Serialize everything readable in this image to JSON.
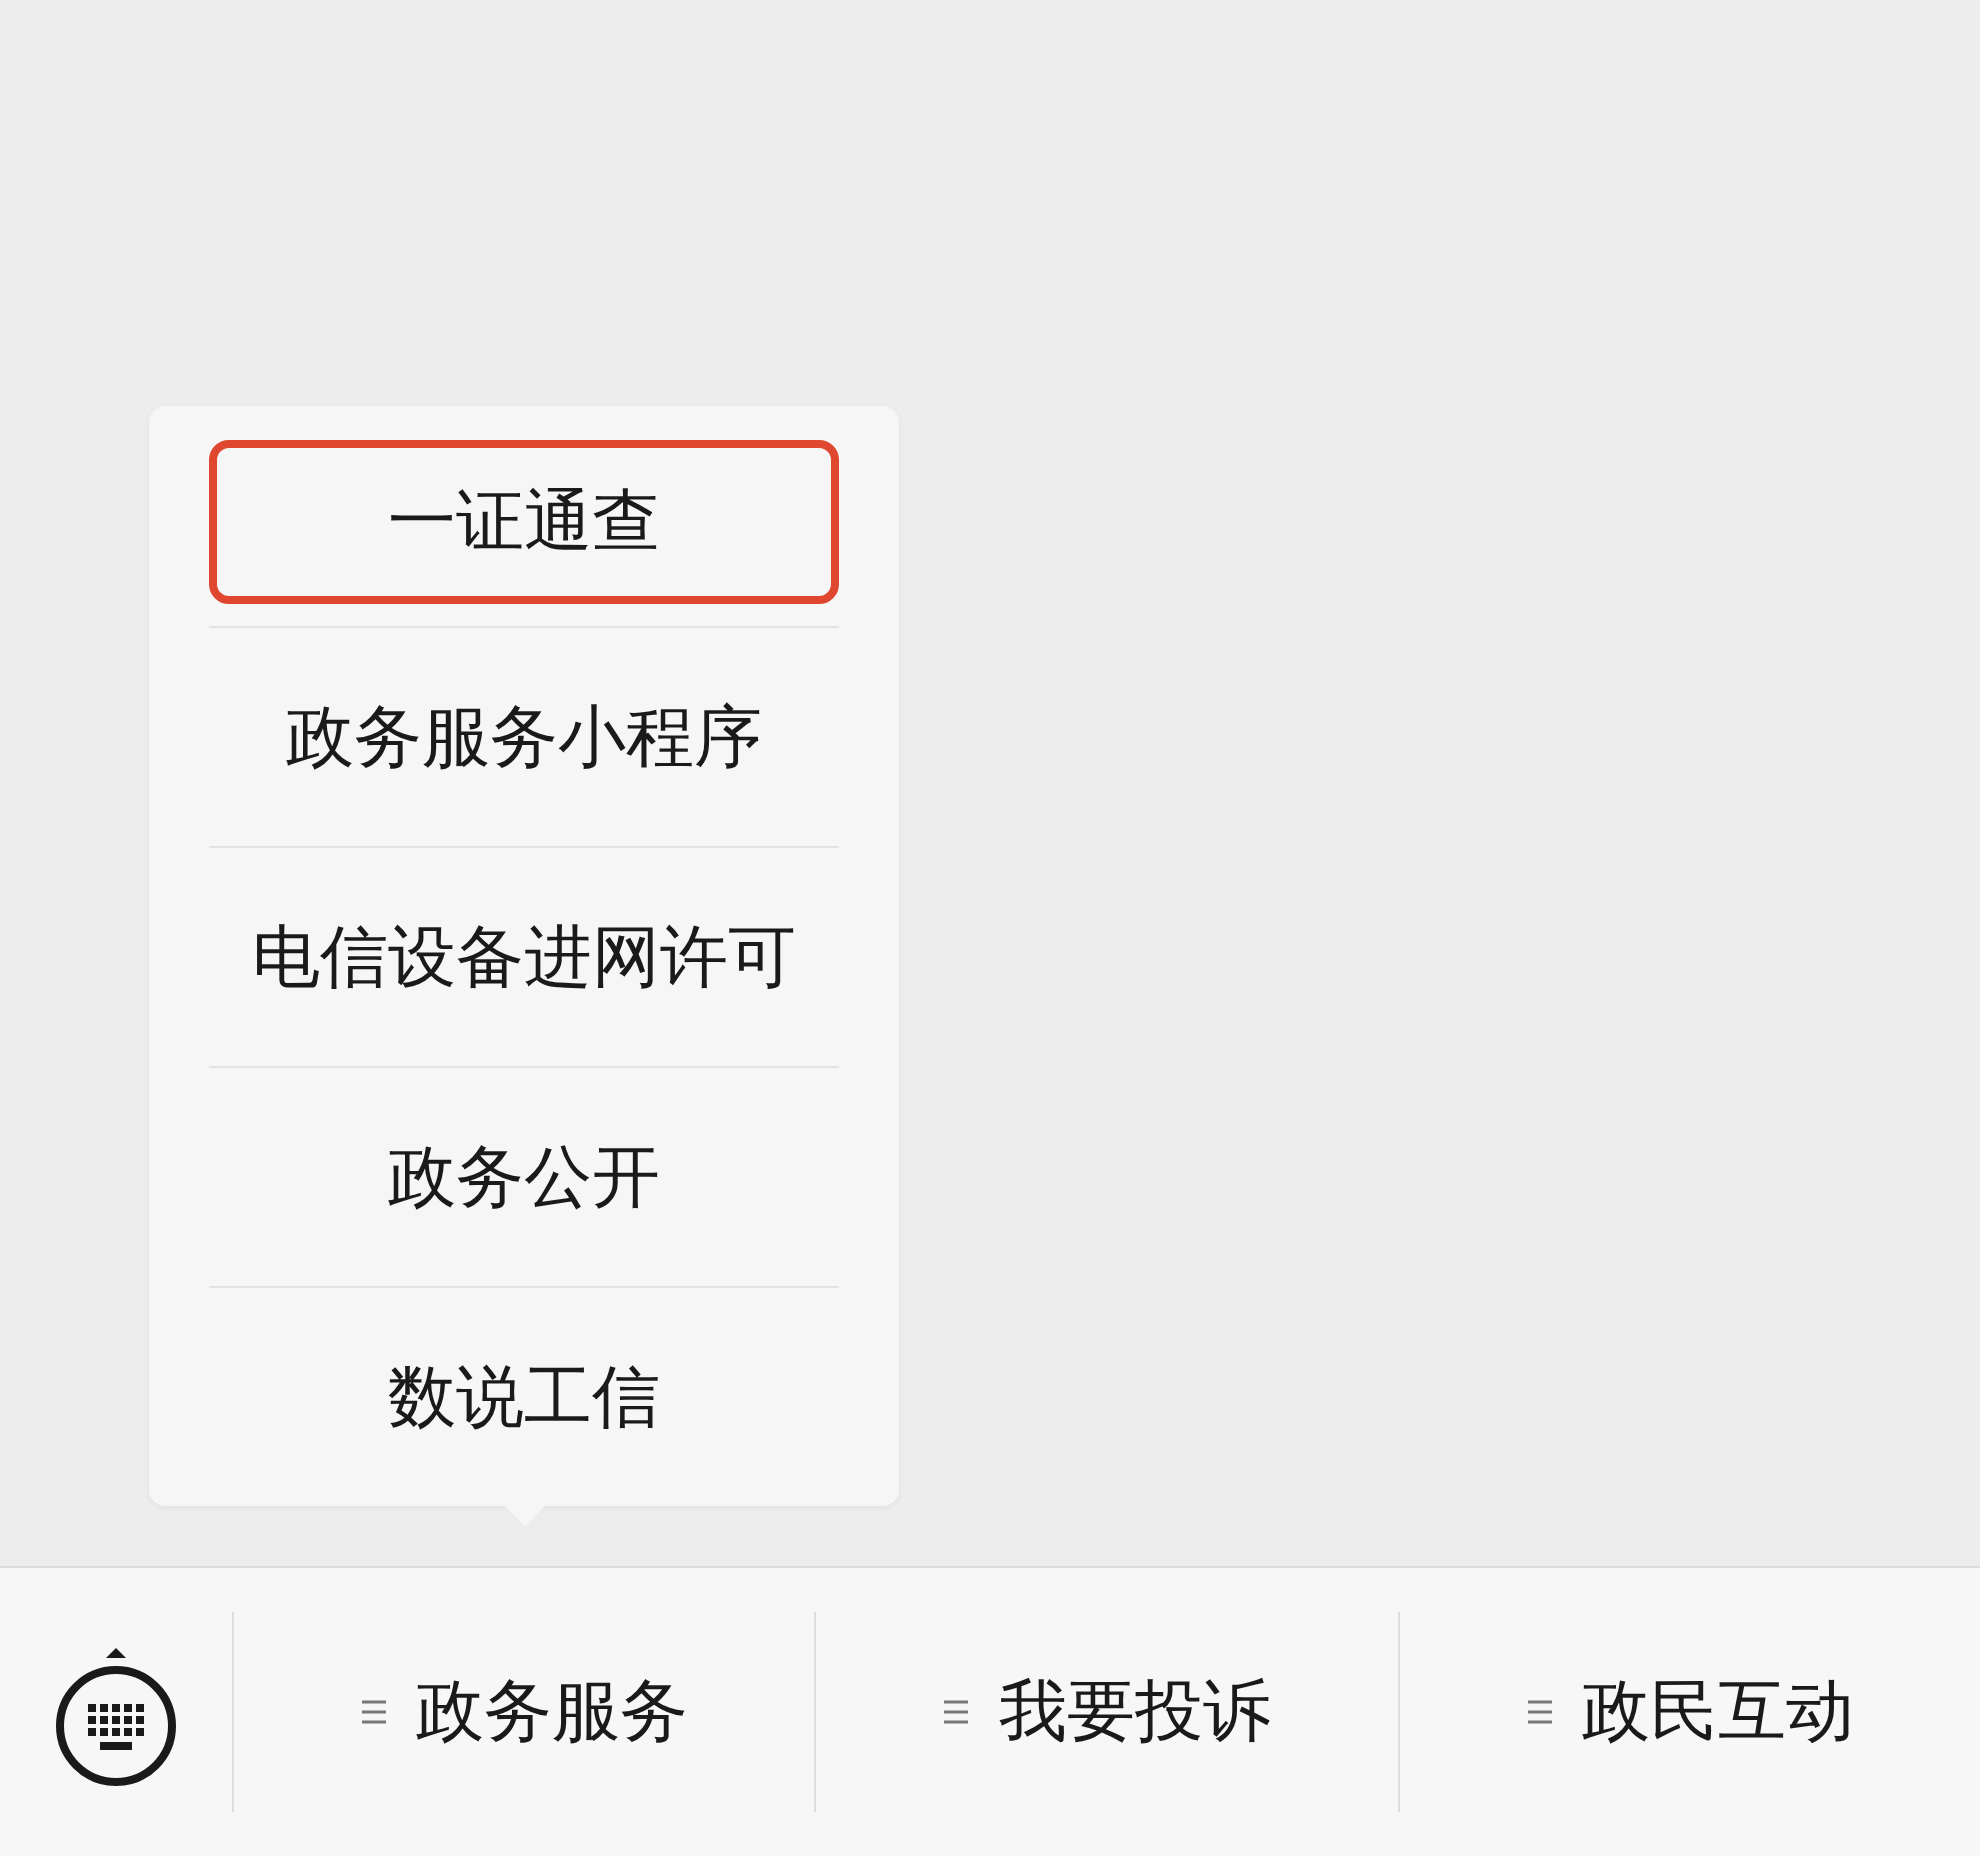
{
  "tabs": [
    {
      "label": "政务服务",
      "submenu": [
        {
          "label": "一证通查",
          "selected": true
        },
        {
          "label": "政务服务小程序",
          "selected": false
        },
        {
          "label": "电信设备进网许可",
          "selected": false
        },
        {
          "label": "政务公开",
          "selected": false
        },
        {
          "label": "数说工信",
          "selected": false
        }
      ]
    },
    {
      "label": "我要投诉"
    },
    {
      "label": "政民互动"
    }
  ]
}
